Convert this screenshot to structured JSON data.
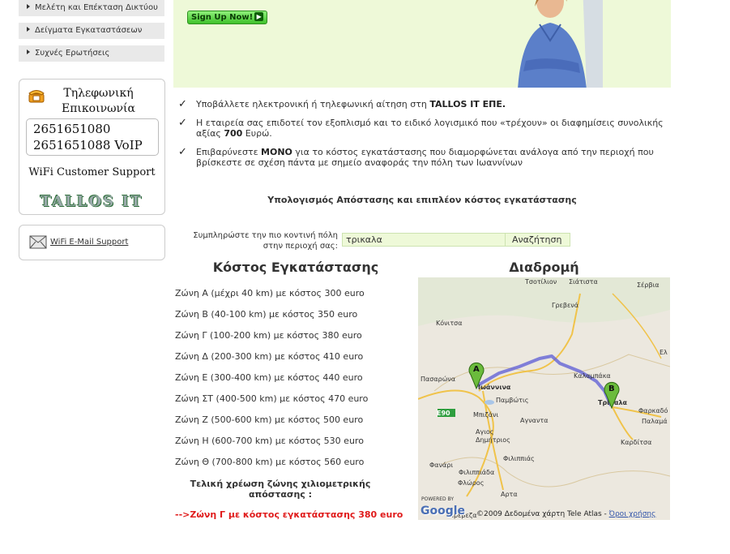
{
  "sidebar": {
    "menu": [
      {
        "label": "Μελέτη και Επέκταση Δικτύου"
      },
      {
        "label": "Δείγματα Εγκαταστάσεων"
      },
      {
        "label": "Συχνές Ερωτήσεις"
      }
    ],
    "phone": {
      "title_line1": "Τηλεφωνική",
      "title_line2": "Επικοινωνία",
      "number1": "2651651080",
      "number2": "2651651088 VoIP",
      "support": "WiFi Customer Support",
      "logo": "TALLOS IT"
    },
    "email": {
      "label": "WiFi E-Mail Support"
    }
  },
  "banner": {
    "signup": "Sign Up Now!",
    "signup_icon": "arrow-right"
  },
  "bullets": [
    {
      "text": "Υποβάλλετε ηλεκτρονική ή τηλεφωνική αίτηση στη ",
      "bold": "TALLOS IT ΕΠΕ."
    },
    {
      "text": "Η εταιρεία σας επιδοτεί τον εξοπλισμό και το ειδικό λογισμικό που «τρέχουν» οι διαφημίσεις συνολικής αξίας ",
      "bold": "700",
      "tail": " Ευρώ."
    },
    {
      "text": "Επιβαρύνεστε ",
      "bold": "ΜΟΝΟ",
      "tail": " για το κόστος εγκατάστασης που διαμορφώνεται ανάλογα από την περιοχή που βρίσκεστε σε σχέση πάντα με σημείο αναφοράς την πόλη των Ιωαννίνων"
    }
  ],
  "section_title": "Υπολογισμός Απόστασης και επιπλέον κόστος εγκατάστασης",
  "search": {
    "label": "Συμπληρώστε την πιο κοντινή πόλη στην περιοχή σας:",
    "value": "τρικαλα",
    "button": "Αναζήτηση"
  },
  "costs": {
    "heading": "Κόστος Εγκατάστασης",
    "zones": [
      "Ζώνη Α (μέχρι 40 km) με κόστος 300 euro",
      "Ζώνη Β (40-100 km) με κόστος 350 euro",
      "Ζώνη Γ (100-200 km) με κόστος 380 euro",
      "Ζώνη Δ (200-300 km) με κόστος 410 euro",
      "Ζώνη Ε (300-400 km) με κόστος 440 euro",
      "Ζώνη ΣΤ (400-500 km) με κόστος 470 euro",
      "Ζώνη Ζ (500-600 km) με κόστος 500 euro",
      "Ζώνη Η (600-700 km) με κόστος 530 euro",
      "Ζώνη Θ (700-800 km) με κόστος 560 euro"
    ],
    "final_label": "Τελική χρέωση ζώνης χιλιομετρικής απόστασης :",
    "final_result": "-->Ζώνη Γ με κόστος εγκατάστασης 380 euro"
  },
  "route": {
    "heading": "Διαδρομή",
    "marker_a": "A",
    "marker_b": "B",
    "places": [
      "Τσοτίλιον",
      "Σιάτιστα",
      "Σέρβια",
      "Κόνιτσα",
      "Γρεβενά",
      "Ελ",
      "Καλαμπάκα",
      "Πασαρώνα",
      "Ιωάννινα",
      "Παμβώτις",
      "Τρίκαλα",
      "Φαρκαδό",
      "Παλαμά",
      "Μπιζάνι",
      "Αγναντα",
      "Καρδίτσα",
      "Αγιος Δημήτριος",
      "Φιλιππιάς",
      "Φανάρι",
      "Φιλιππιάδα",
      "Φλώρος",
      "Αρτα",
      "Πρέβεζα",
      "E90"
    ],
    "powered": "POWERED BY",
    "google": "Google",
    "copyright": "©2009 Δεδομένα χάρτη Tele Atlas - ",
    "terms": "Όροι χρήσης"
  }
}
